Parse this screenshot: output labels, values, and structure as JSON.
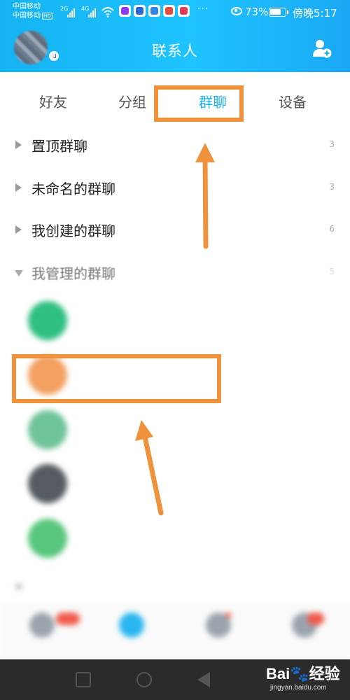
{
  "status_bar": {
    "carrier_1": "中国移动",
    "carrier_2": "中国移动",
    "hd_badge": "HD",
    "net_1": "2G",
    "net_2": "4G",
    "more": "···",
    "battery_percent": "73%",
    "battery_level": 0.73,
    "clock": "傍晚5:17",
    "app_icon_colors": [
      "#8a3cf0",
      "#2a66d8",
      "#2f86e8",
      "#e84b3c",
      "#e13a5b"
    ]
  },
  "header": {
    "title": "联系人",
    "avatar_icon": "user-avatar",
    "add_friend_icon": "add-person-icon",
    "accent_color": "#1ab2ef"
  },
  "tabs": [
    {
      "label": "好友",
      "active": false
    },
    {
      "label": "分组",
      "active": false
    },
    {
      "label": "群聊",
      "active": true
    },
    {
      "label": "设备",
      "active": false
    }
  ],
  "groups": [
    {
      "name": "置顶群聊",
      "count": "3",
      "expanded": false
    },
    {
      "name": "未命名的群聊",
      "count": "3",
      "expanded": false
    },
    {
      "name": "我创建的群聊",
      "count": "6",
      "expanded": false
    },
    {
      "name": "我管理的群聊",
      "count": "5",
      "expanded": true
    }
  ],
  "managed_chats": [
    {
      "name": "",
      "avatar_color": "#2fbf82"
    },
    {
      "name": "",
      "avatar_color": "#f4a061"
    },
    {
      "name": "",
      "avatar_color": "#6fc39a"
    },
    {
      "name": "",
      "avatar_color": "#555b60"
    },
    {
      "name": "",
      "avatar_color": "#59c77d"
    }
  ],
  "joined_group": {
    "name": "",
    "count": ""
  },
  "bottom_nav": [
    {
      "label": "",
      "badge": "",
      "active": false
    },
    {
      "label": "",
      "badge": "",
      "active": true
    },
    {
      "label": "",
      "badge": "",
      "active": false
    },
    {
      "label": "",
      "badge": "",
      "active": false
    }
  ],
  "annotations": {
    "highlight_color": "#f0923b"
  },
  "watermark": {
    "brand": "Bai",
    "brand_suffix": "经验",
    "url": "jingyan.baidu.com"
  }
}
